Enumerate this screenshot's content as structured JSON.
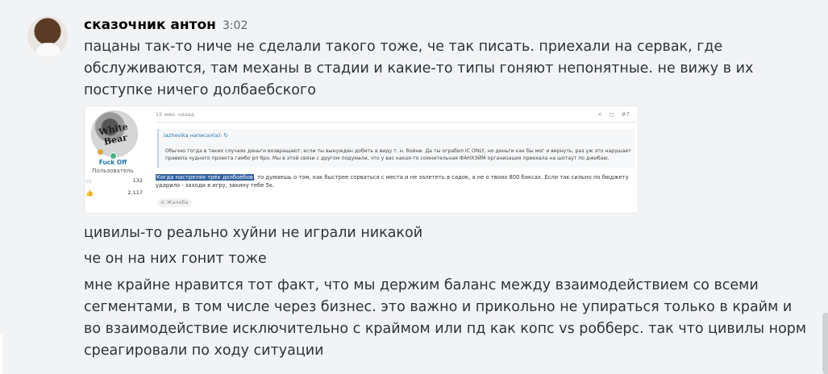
{
  "message": {
    "username": "сказочник антон",
    "timestamp": "3:02",
    "line_1": "пацаны так-то ниче не сделали такого тоже, че так писать. приехали на сервак, где обслуживаются, там механы в стадии и какие-то типы гоняют непонятные. не вижу в их поступке ничего долбаебского",
    "line_2": "цивилы-то реально хуйни не играли никакой",
    "line_3": "че он на них гонит тоже",
    "line_4": "мне крайне нравится тот факт, что мы держим баланс между взаимодействием со всеми сегментами, в том числе через бизнес. это важно и прикольно не упираться только в крайм и во взаимодействие исключительно с краймом или пд как копс vs робберс. так что цивилы норм среагировали по ходу ситуации"
  },
  "embed": {
    "forum_user": {
      "avatar_text": "White Bear",
      "name": "Fuck Off",
      "role": "Пользователь",
      "messages_count": "132",
      "reactions_count": "2,117",
      "messages_icon": "comment-icon",
      "reactions_icon": "thumbs-up-icon"
    },
    "post": {
      "time": "15 мин. назад",
      "actions": {
        "share": "<",
        "bookmark": "◻",
        "number": "#7"
      },
      "quote_author": "iazhevika написал(а): ↻",
      "quote_body": "Обычно тогда в таких случаях деньги возвращают, если ты вынужден добить в виду т. н. бойни. Да ты ограбил IC ONLY, но деньги как бы мог и вернуть, раз уж это нарушает правила чудного проекта гамбо рп бро. Мы в этой связи с другом подумали, что у вас какая-то сомнительная ФАНХЭЙМ организация приехала на шотаут по джибаю.",
      "reply_highlight": "Когда настреляя трёх долбоёбов",
      "reply_rest": ", то думаешь о том, как быстрее сорваться с места и не залететь в садок, а не о твоих 800 баксах. Если так сильно по бюджету ударило - заходи в игру, закину тебе 5к.",
      "report_label": "⊘ Жалоба"
    }
  },
  "colors": {
    "background": "#f2f3f5",
    "username": "#060607",
    "text": "#2e3338",
    "forum_link": "#2577b1",
    "highlight": "#2f5f9e"
  }
}
